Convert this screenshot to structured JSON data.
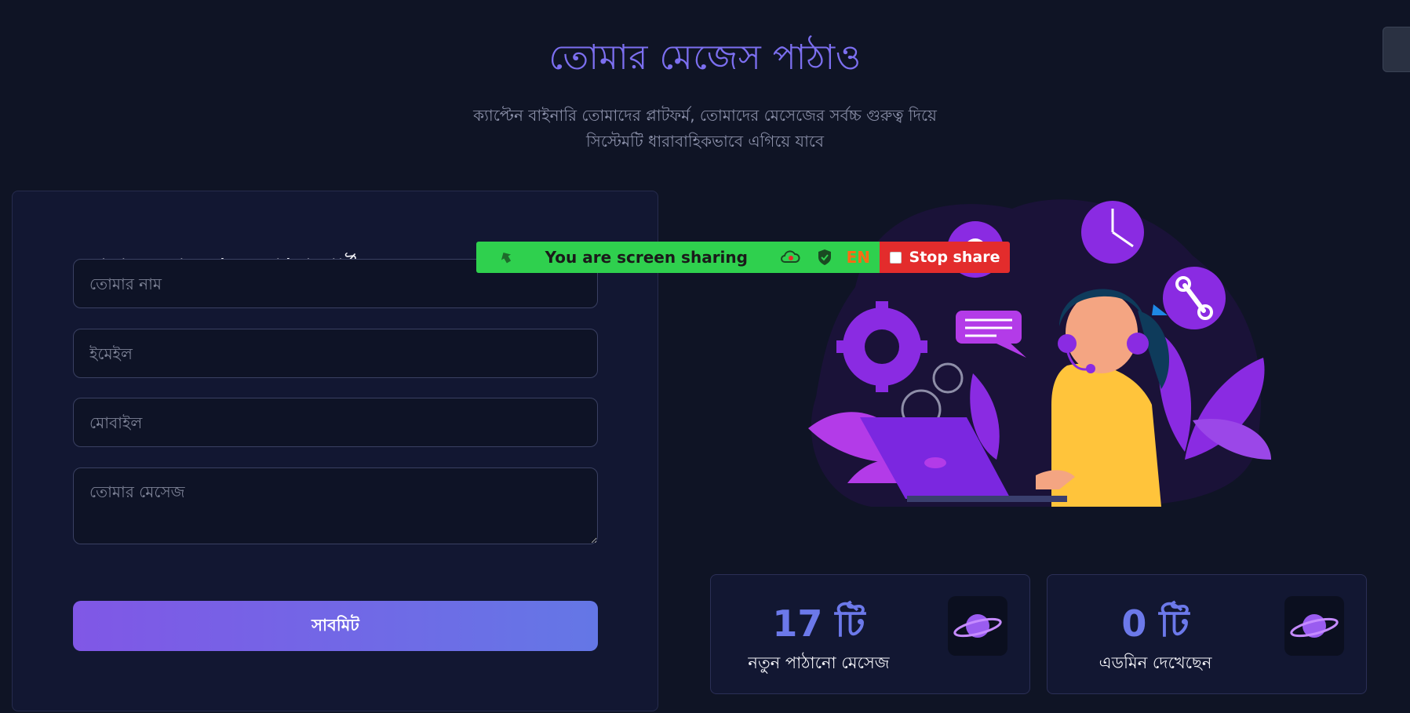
{
  "hero": {
    "title": "তোমার মেজেস পাঠাও",
    "subtitle_line1": "ক্যাপ্টেন বাইনারি তোমাদের প্লাটফর্ম, তোমাদের মেসেজের সর্বচ্চ গুরুত্ব দিয়ে",
    "subtitle_line2": "সিস্টেমটি ধারাবাহিকভাবে এগিয়ে যাবে"
  },
  "form": {
    "heading": "তোমার মতামত/সমস্যা/সাপোর্ট",
    "name_placeholder": "তোমার নাম",
    "email_placeholder": "ইমেইল",
    "mobile_placeholder": "মোবাইল",
    "message_placeholder": "তোমার মেসেজ",
    "submit_label": "সাবমিট"
  },
  "screen_share": {
    "status_text": "You are screen sharing",
    "language": "EN",
    "stop_label": "Stop share",
    "bar_color": "#2fd04e",
    "stop_color": "#e32c2c"
  },
  "stats": [
    {
      "value": "17 টি",
      "label": "নতুন পাঠানো মেসেজ",
      "icon": "planet-icon"
    },
    {
      "value": "0 টি",
      "label": "এডমিন দেখেছেন",
      "icon": "planet-icon"
    }
  ],
  "colors": {
    "background": "#0f1425",
    "accent": "#7c6ff0",
    "card": "#121732",
    "illustration_purple": "#8a2be2"
  }
}
